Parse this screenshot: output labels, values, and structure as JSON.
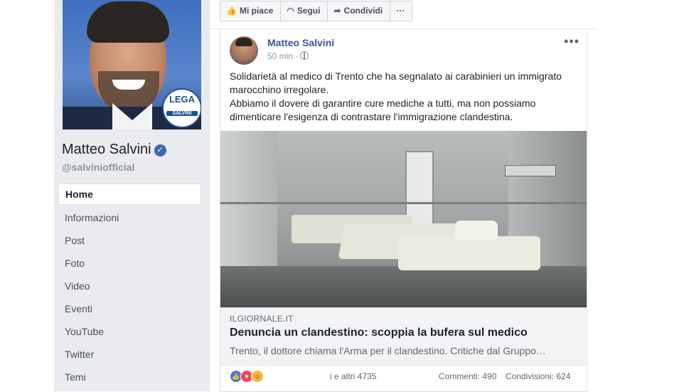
{
  "page": {
    "name": "Matteo Salvini",
    "handle": "@salviniofficial",
    "profile_badge": {
      "top": "LEGA",
      "bottom": "SALVINI"
    }
  },
  "action_bar": {
    "like_label": "Mi piace",
    "follow_label": "Segui",
    "share_label": "Condividi",
    "more_label": "···"
  },
  "nav": {
    "items": [
      {
        "label": "Home",
        "active": true
      },
      {
        "label": "Informazioni"
      },
      {
        "label": "Post"
      },
      {
        "label": "Foto"
      },
      {
        "label": "Video"
      },
      {
        "label": "Eventi"
      },
      {
        "label": "YouTube"
      },
      {
        "label": "Twitter"
      },
      {
        "label": "Temi"
      }
    ]
  },
  "post": {
    "author": "Matteo Salvini",
    "time": "50 min ·",
    "more_label": "•••",
    "text_line1": "Solidarietà al medico di Trento che ha segnalato ai carabinieri un immigrato marocchino irregolare.",
    "text_line2": "Abbiamo il dovere di garantire cure mediche a tutti, ma non possiamo dimenticare l'esigenza di contrastare l'immigrazione clandestina.",
    "link": {
      "domain": "ILGIORNALE.IT",
      "title": "Denuncia un clandestino: scoppia la bufera sul medico",
      "description": "Trento, il dottore chiama l'Arma per il clandestino. Critiche dal Gruppo…"
    },
    "reactions_count": "i e altri 4735",
    "comments": "Commenti: 490",
    "shares": "Condivisioni: 624"
  },
  "colors": {
    "link_blue": "#365899",
    "verified_blue": "#4267b2",
    "left_panel_bg": "#e9ebee"
  }
}
